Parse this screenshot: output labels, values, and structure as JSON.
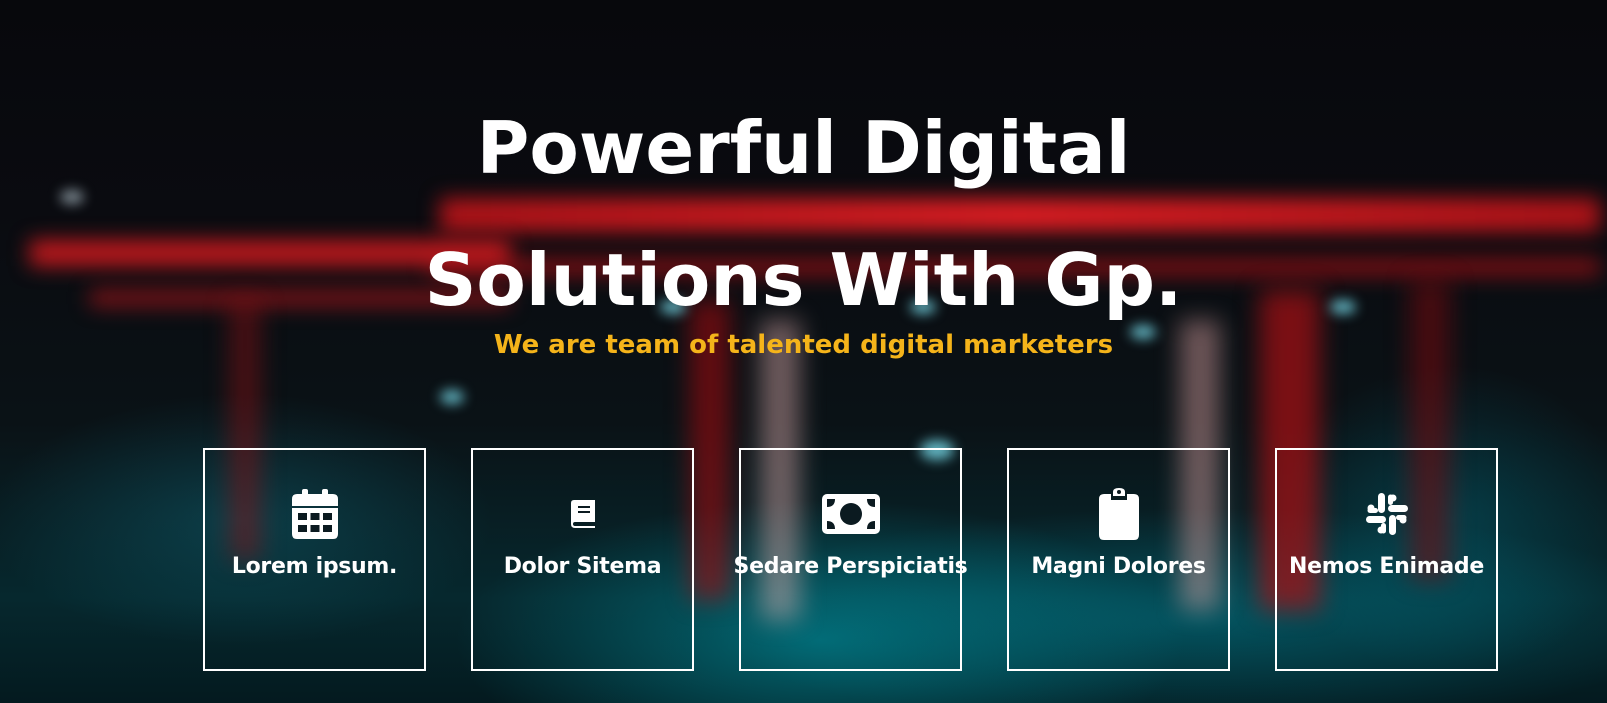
{
  "hero": {
    "headline_line1": "Powerful Digital",
    "headline_line2": "Solutions With Gp.",
    "subtitle": "We are team of talented digital marketers",
    "accent_color": "#f5b41a"
  },
  "features": [
    {
      "label": "Lorem ipsum.",
      "icon": "calendar-icon"
    },
    {
      "label": "Dolor Sitema",
      "icon": "book-icon"
    },
    {
      "label": "Sedare Perspiciatis",
      "icon": "money-bill-icon"
    },
    {
      "label": "Magni Dolores",
      "icon": "clipboard-icon"
    },
    {
      "label": "Nemos Enimade",
      "icon": "slack-icon"
    }
  ]
}
